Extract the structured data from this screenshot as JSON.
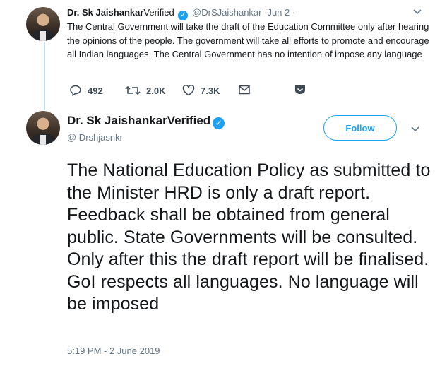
{
  "reply_tweet": {
    "name": "Dr. Sk Jaishankar",
    "verified_label": "Verified",
    "handle": "@DrSJaishankar",
    "date": "·Jun 2 ·",
    "text": "The Central Government will take the draft of the Education Committee only after hearing the opinions of the people. The government will take all efforts to promote and encourage all Indian languages. The Central Government has no intention of impose any language",
    "actions": {
      "replies": "492",
      "retweets": "2.0K",
      "likes": "7.3K"
    }
  },
  "main_tweet": {
    "name": "Dr. Sk JaishankarVerified",
    "handle": "@ Drshjasnkr",
    "follow_label": "Follow",
    "text": "The National Education Policy as submitted to the Minister HRD is only a draft report. Feedback shall be obtained from general public. State Governments will be consulted. Only after this the draft report will be finalised. GoI respects all languages. No language will be imposed",
    "timestamp": "5:19 PM - 2 June 2019"
  },
  "icons": {
    "verified": "verified-badge-icon",
    "reply": "reply-icon",
    "retweet": "retweet-icon",
    "like": "heart-icon",
    "dm": "envelope-icon",
    "save": "bookmark-icon",
    "more": "chevron-down-icon"
  },
  "colors": {
    "accent": "#1da1f2",
    "secondary_text": "#657786",
    "thread_line": "#bde0f5"
  }
}
